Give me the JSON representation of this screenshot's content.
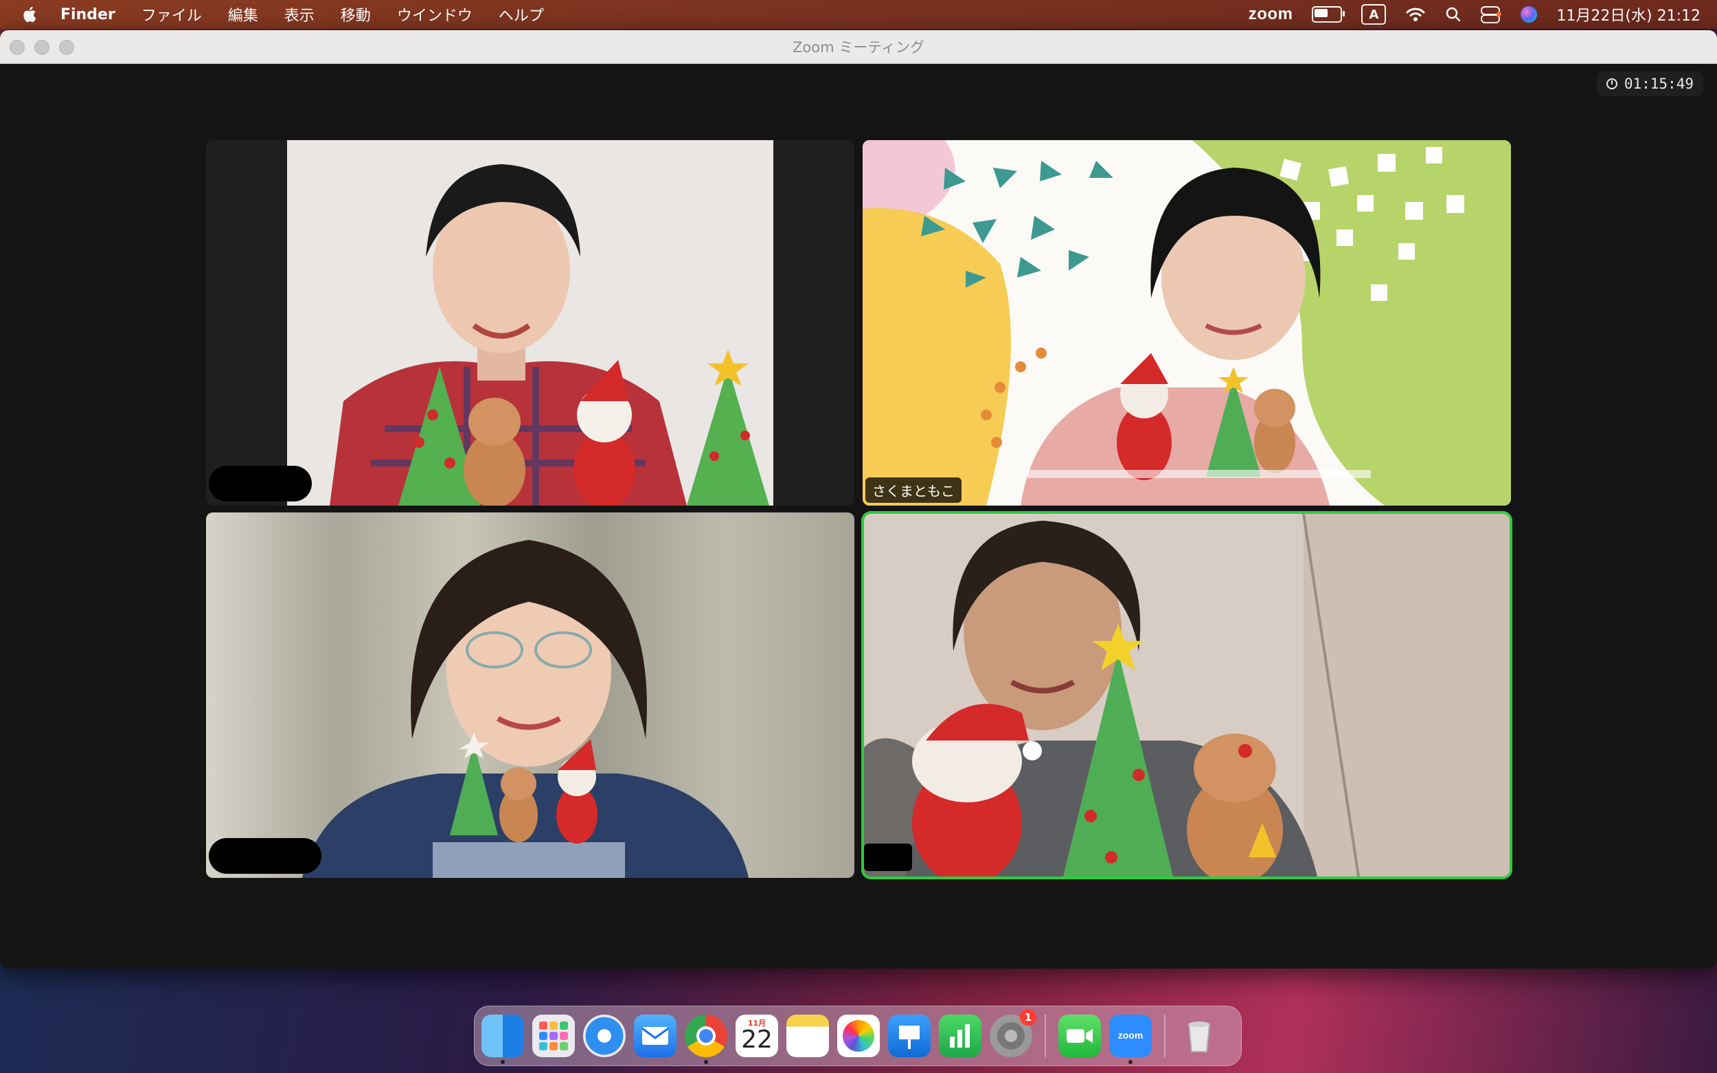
{
  "menubar": {
    "app_name": "Finder",
    "menus": [
      "ファイル",
      "編集",
      "表示",
      "移動",
      "ウインドウ",
      "ヘルプ"
    ],
    "status_app": "zoom",
    "input_source": "A",
    "clock": "11月22日(水) 21:12",
    "battery_level": 0.6
  },
  "window": {
    "title": "Zoom ミーティング",
    "timer": "01:15:49"
  },
  "participants": [
    {
      "name": "",
      "active": false
    },
    {
      "name": "さくまともこ",
      "active": false
    },
    {
      "name": "",
      "active": false
    },
    {
      "name": "",
      "active": true
    }
  ],
  "dock": {
    "apps": [
      {
        "name": "Finder",
        "icon": "finder-icon"
      },
      {
        "name": "Launchpad",
        "icon": "launchpad-icon"
      },
      {
        "name": "Safari",
        "icon": "safari-icon"
      },
      {
        "name": "Mail",
        "icon": "mail-icon"
      },
      {
        "name": "Chrome",
        "icon": "chrome-icon"
      },
      {
        "name": "Calendar",
        "icon": "calendar-icon"
      },
      {
        "name": "Notes",
        "icon": "notes-icon"
      },
      {
        "name": "Photos",
        "icon": "photos-icon"
      },
      {
        "name": "Keynote",
        "icon": "keynote-icon"
      },
      {
        "name": "Numbers",
        "icon": "numbers-icon"
      },
      {
        "name": "System Settings",
        "icon": "settings-icon"
      },
      {
        "name": "FaceTime",
        "icon": "facetime-icon"
      },
      {
        "name": "zoom",
        "icon": "zoom-icon"
      },
      {
        "name": "Trash",
        "icon": "trash-icon"
      }
    ],
    "calendar_month": "11月",
    "calendar_day": "22",
    "settings_badge": "1",
    "zoom_label": "zoom"
  },
  "colors": {
    "active_speaker": "#2ecc40",
    "menubar": "#7a3220"
  }
}
